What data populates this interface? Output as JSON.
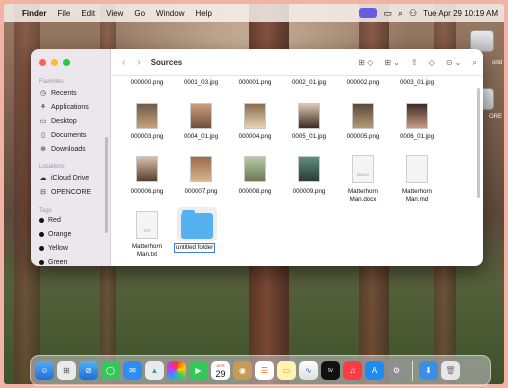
{
  "menubar": {
    "apple_icon": "apple-icon",
    "app": "Finder",
    "items": [
      "File",
      "Edit",
      "View",
      "Go",
      "Window",
      "Help"
    ],
    "datetime": "Tue Apr 29  10:19 AM"
  },
  "desktop": {
    "icons": [
      {
        "label": "orld",
        "icon": "drive-icon"
      },
      {
        "label": "ORE",
        "icon": "drive-icon"
      }
    ]
  },
  "finder": {
    "title": "Sources",
    "sidebar": {
      "favorites_label": "Favorites",
      "favorites": [
        {
          "label": "Recents",
          "icon": "clock-icon"
        },
        {
          "label": "Applications",
          "icon": "applications-icon"
        },
        {
          "label": "Desktop",
          "icon": "desktop-icon"
        },
        {
          "label": "Documents",
          "icon": "document-icon"
        },
        {
          "label": "Downloads",
          "icon": "download-icon"
        }
      ],
      "locations_label": "Locations",
      "locations": [
        {
          "label": "iCloud Drive",
          "icon": "cloud-icon"
        },
        {
          "label": "OPENCORE",
          "icon": "drive-icon"
        }
      ],
      "tags_label": "Tags",
      "tags": [
        {
          "label": "Red",
          "color": "#111111"
        },
        {
          "label": "Orange",
          "color": "#111111"
        },
        {
          "label": "Yellow",
          "color": "#111111"
        },
        {
          "label": "Green",
          "color": "#111111"
        }
      ]
    },
    "files_row0": [
      "000000.png",
      "0001_03.jpg",
      "000001.png",
      "0002_01.jpg",
      "000002.png",
      "0003_01.jpg"
    ],
    "files_row1": [
      "000003.png",
      "0004_01.jpg",
      "000004.png",
      "0005_01.jpg",
      "000005.png",
      "0006_01.jpg"
    ],
    "files_row2": [
      "000006.png",
      "000007.png",
      "000008.png",
      "000009.png",
      "Matterhorn Man.docx",
      "Matterhorn Man.md"
    ],
    "files_row3": [
      "Matterhorn Man.txt",
      "untitled folder"
    ],
    "doc_badges": {
      "docx": "DOCX",
      "txt": "TXT"
    },
    "accent": "#3d7cf2"
  },
  "dock": {
    "calendar_month": "APR",
    "calendar_day": "29",
    "tv_label": "tv"
  }
}
